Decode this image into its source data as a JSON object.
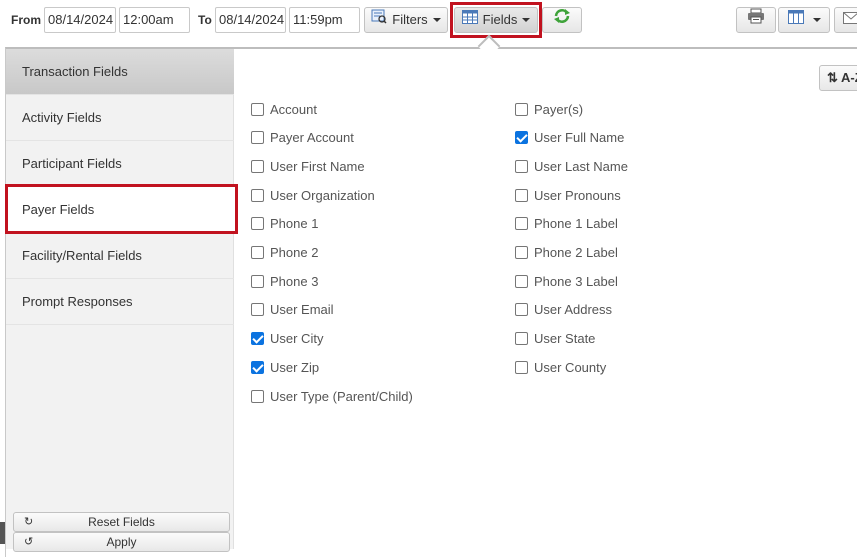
{
  "toolbar": {
    "from_label": "From",
    "from_date": "08/14/2024",
    "from_time": "12:00am",
    "to_label": "To",
    "to_date": "08/14/2024",
    "to_time": "11:59pm",
    "filters_label": "Filters",
    "fields_label": "Fields",
    "icons": [
      "filter-icon",
      "grid-icon",
      "refresh-icon",
      "print-icon",
      "columns-icon",
      "mail-icon"
    ]
  },
  "sidebar": {
    "items": [
      {
        "label": "Transaction Fields"
      },
      {
        "label": "Activity Fields"
      },
      {
        "label": "Participant Fields"
      },
      {
        "label": "Payer Fields"
      },
      {
        "label": "Facility/Rental Fields"
      },
      {
        "label": "Prompt Responses"
      }
    ],
    "reset_label": "Reset Fields",
    "apply_label": "Apply"
  },
  "sort": {
    "label": "A-Z"
  },
  "fields_col1": [
    {
      "label": "Account",
      "checked": false
    },
    {
      "label": "Payer Account",
      "checked": false
    },
    {
      "label": "User First Name",
      "checked": false
    },
    {
      "label": "User Organization",
      "checked": false
    },
    {
      "label": "Phone 1",
      "checked": false
    },
    {
      "label": "Phone 2",
      "checked": false
    },
    {
      "label": "Phone 3",
      "checked": false
    },
    {
      "label": "User Email",
      "checked": false
    },
    {
      "label": "User City",
      "checked": true
    },
    {
      "label": "User Zip",
      "checked": true
    },
    {
      "label": "User Type (Parent/Child)",
      "checked": false
    }
  ],
  "fields_col2": [
    {
      "label": "Payer(s)",
      "checked": false
    },
    {
      "label": "User Full Name",
      "checked": true
    },
    {
      "label": "User Last Name",
      "checked": false
    },
    {
      "label": "User Pronouns",
      "checked": false
    },
    {
      "label": "Phone 1 Label",
      "checked": false
    },
    {
      "label": "Phone 2 Label",
      "checked": false
    },
    {
      "label": "Phone 3 Label",
      "checked": false
    },
    {
      "label": "User Address",
      "checked": false
    },
    {
      "label": "User State",
      "checked": false
    },
    {
      "label": "User County",
      "checked": false
    }
  ],
  "colors": {
    "highlight": "#c1121f",
    "checkbox_checked": "#0b73e0",
    "refresh_green": "#3fa33a"
  }
}
